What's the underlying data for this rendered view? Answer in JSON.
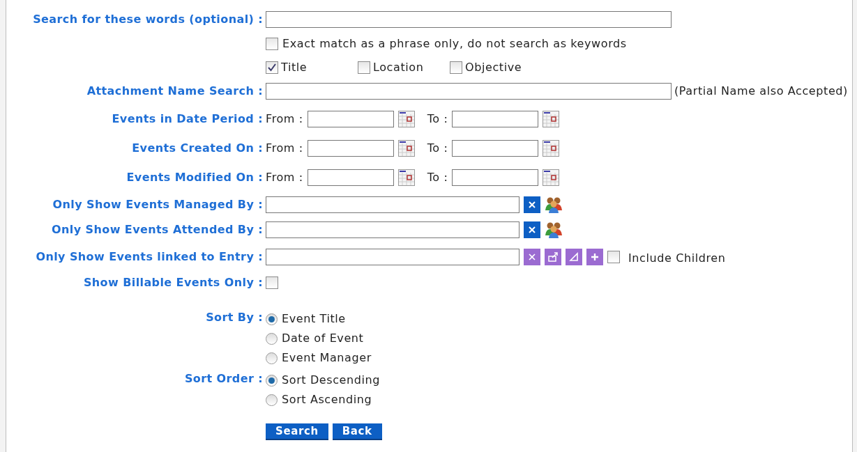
{
  "keyword_search": {
    "label": "Search for these words (optional) :",
    "options": [
      {
        "label": "Exact match as a phrase only, do not search as keywords",
        "checked": false
      }
    ],
    "fields": [
      {
        "label": "Title",
        "checked": true
      },
      {
        "label": "Location",
        "checked": false
      },
      {
        "label": "Objective",
        "checked": false
      }
    ]
  },
  "attachment_search": {
    "label": "Attachment Name Search :",
    "note": "(Partial Name also Accepted)"
  },
  "date_ranges": [
    {
      "label": "Events in Date Period :",
      "from_label": "From :",
      "to_label": "To :"
    },
    {
      "label": "Events Created On :",
      "from_label": "From :",
      "to_label": "To :"
    },
    {
      "label": "Events Modified On :",
      "from_label": "From :",
      "to_label": "To :"
    }
  ],
  "people_filters": [
    {
      "label": "Only Show Events Managed By :"
    },
    {
      "label": "Only Show Events Attended By :"
    }
  ],
  "entry_link": {
    "label": "Only Show Events linked to Entry :",
    "include_children": {
      "label": "Include Children",
      "checked": false
    }
  },
  "billable": {
    "label": "Show Billable Events Only :",
    "checked": false
  },
  "sort_by": {
    "label": "Sort By :",
    "options": [
      {
        "label": "Event Title",
        "selected": true
      },
      {
        "label": "Date of Event",
        "selected": false
      },
      {
        "label": "Event Manager",
        "selected": false
      }
    ]
  },
  "sort_order": {
    "label": "Sort Order :",
    "options": [
      {
        "label": "Sort Descending",
        "selected": true
      },
      {
        "label": "Sort Ascending",
        "selected": false
      }
    ]
  },
  "buttons": [
    {
      "label": "Search"
    },
    {
      "label": "Back"
    }
  ]
}
